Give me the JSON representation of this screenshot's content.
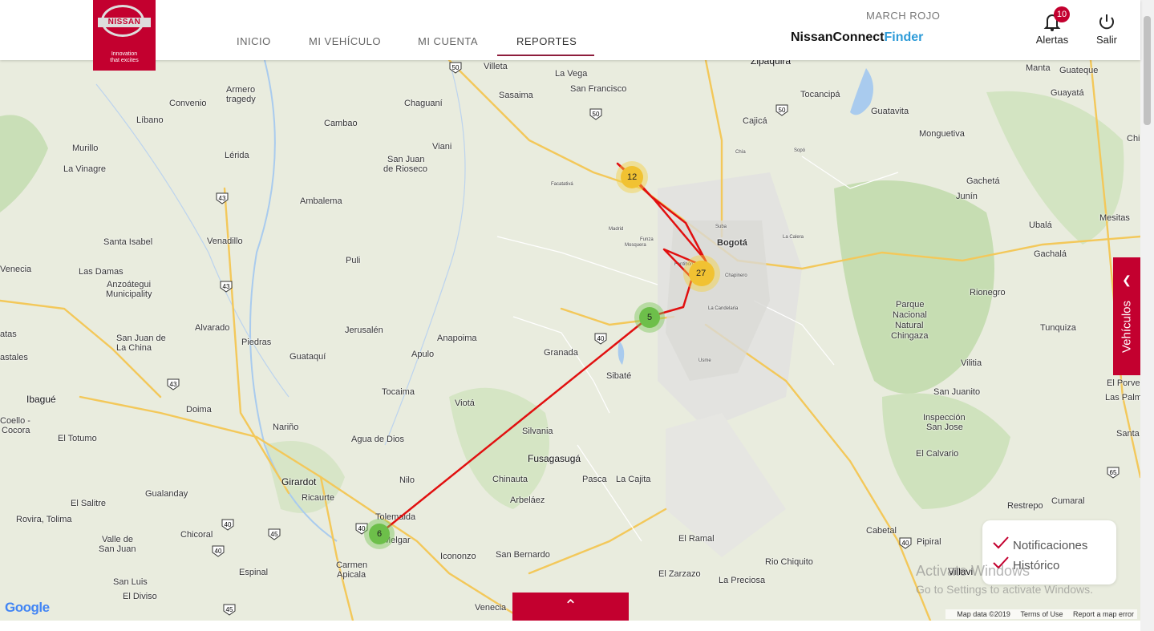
{
  "header": {
    "logo_brand": "NISSAN",
    "logo_tagline_1": "Innovation",
    "logo_tagline_2": "that excites",
    "nav": [
      "INICIO",
      "MI VEHÍCULO",
      "MI CUENTA",
      "REPORTES"
    ],
    "active_nav": "REPORTES",
    "user_name": "MARCH ROJO",
    "brand_prefix": "NissanConnect",
    "brand_suffix": "Finder",
    "alerts_label": "Alertas",
    "alerts_count": "10",
    "logout_label": "Salir"
  },
  "map": {
    "places": [
      "Zipaquirá",
      "Villeta",
      "La Vega",
      "San Francisco",
      "Sasaima",
      "Tocancipá",
      "Guatavita",
      "Manta",
      "Guateque",
      "Guayatá",
      "Armero",
      "tragedy",
      "Convenio",
      "Líbano",
      "Chaguaní",
      "Cambao",
      "Murillo",
      "Lérida",
      "Viani",
      "San Juan",
      "de Rioseco",
      "La Vinagre",
      "Ambalema",
      "Santa Isabel",
      "Venadillo",
      "Puli",
      "Bogotá",
      "Funza",
      "Mosquera",
      "Madrid",
      "Facatativá",
      "Las Damas",
      "Anzoátegui",
      "Municipality",
      "Venecia",
      "Alvarado",
      "Piedras",
      "Jerusalén",
      "Guataquí",
      "Anapoima",
      "Apulo",
      "Granada",
      "Sibaté",
      "San Juan de",
      "La China",
      "Ibagué",
      "Coello -",
      "Cocora",
      "El Totumo",
      "Doima",
      "Tocaima",
      "Viotá",
      "Nariño",
      "Agua de Dios",
      "Silvania",
      "Fusagasugá",
      "Girardot",
      "Ricaurte",
      "Nilo",
      "Chinauta",
      "Arbeláez",
      "Pasca",
      "La Cajita",
      "Tolemaida",
      "Melgar",
      "Icononzo",
      "San Bernardo",
      "Gualanday",
      "El Salitre",
      "Rovira, Tolima",
      "Valle de",
      "San Juan",
      "Chicoral",
      "Espinal",
      "Carmen",
      "Apicala",
      "San Luis",
      "El Diviso",
      "Venecia",
      "El Ramal",
      "El Zarzazo",
      "La Preciosa",
      "Rio Chiquito",
      "Villavi",
      "Restrepo",
      "Cumaral",
      "Cabetal",
      "Pipiral",
      "El Calvario",
      "Inspección",
      "San Jose",
      "San Juanito",
      "Vilitia",
      "Tunquiza",
      "Rionegro",
      "Parque",
      "Nacional",
      "Natural",
      "Chingaza",
      "Gachalá",
      "Ubalá",
      "Junín",
      "Gachetá",
      "Monguetiva",
      "Mesitas",
      "El Porvenir",
      "Las Palmas",
      "Santa",
      "Chi",
      "astales",
      "atas",
      "La Candelaria",
      "Chapinero",
      "Suba",
      "Fontibón",
      "Usme",
      "Chía",
      "Cajicá",
      "Sopó",
      "La Calera"
    ],
    "clusters": [
      {
        "label": "12",
        "type": "yellow"
      },
      {
        "label": "27",
        "type": "yellow"
      },
      {
        "label": "5",
        "type": "green"
      },
      {
        "label": "6",
        "type": "green"
      }
    ],
    "road_labels": [
      "50",
      "50",
      "43",
      "43",
      "43",
      "40",
      "40",
      "40",
      "40",
      "45",
      "45",
      "50",
      "65",
      "65",
      "40"
    ],
    "google_label": "Google",
    "footer_data": "Map data ©2019",
    "footer_terms": "Terms of Use",
    "footer_report": "Report a map error",
    "route_color": "#e11010"
  },
  "legend": {
    "items": [
      "Notificaciones",
      "Histórico"
    ],
    "check_color": "#c3002f"
  },
  "vehicles_tab_label": "Vehículos",
  "windows_watermark": {
    "line1": "Activate Windows",
    "line2": "Go to Settings to activate Windows."
  },
  "colors": {
    "brand_red": "#c3002f",
    "finder_blue": "#2d9bd8"
  }
}
